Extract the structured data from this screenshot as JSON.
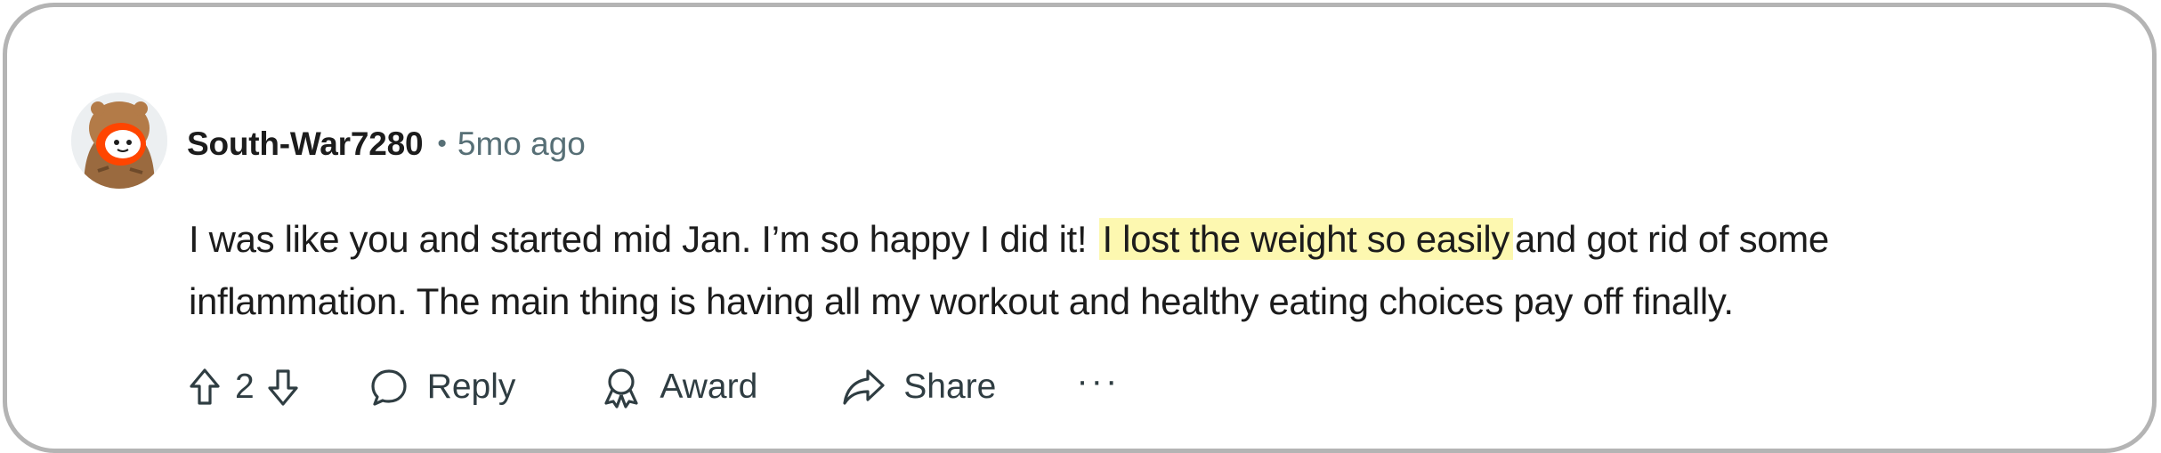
{
  "comment": {
    "author": "South-War7280",
    "separator": "•",
    "time": "5mo ago",
    "body": {
      "line1_before": "I was like you and started mid Jan. I’m so happy I did it!",
      "line1_highlight": "I lost the weight so easily",
      "line1_after": "and got rid of some",
      "line2": "inflammation. The main thing is having all my workout and healthy eating choices pay off finally."
    },
    "highlight_color": "#fdf8b0"
  },
  "actions": {
    "upvote_icon": "arrow-up-icon",
    "vote_count": "2",
    "downvote_icon": "arrow-down-icon",
    "reply_label": "Reply",
    "reply_icon": "speech-bubble-icon",
    "award_label": "Award",
    "award_icon": "award-ribbon-icon",
    "share_label": "Share",
    "share_icon": "share-arrow-icon",
    "more_label": "···"
  },
  "colors": {
    "text": "#1c1c1c",
    "meta": "#576f76",
    "border": "#b4b4b4"
  }
}
